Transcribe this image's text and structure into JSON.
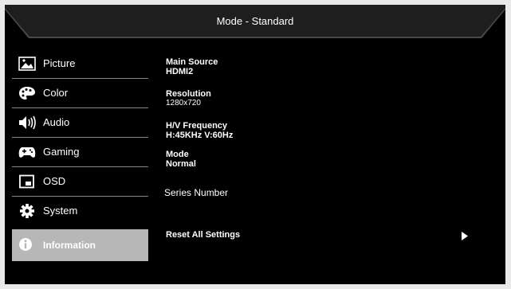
{
  "header": {
    "title": "Mode - Standard"
  },
  "sidebar": {
    "items": [
      {
        "label": "Picture",
        "icon": "picture-icon"
      },
      {
        "label": "Color",
        "icon": "palette-icon"
      },
      {
        "label": "Audio",
        "icon": "speaker-icon"
      },
      {
        "label": "Gaming",
        "icon": "gamepad-icon"
      },
      {
        "label": "OSD",
        "icon": "osd-icon"
      },
      {
        "label": "System",
        "icon": "gear-icon"
      },
      {
        "label": "Information",
        "icon": "info-icon",
        "active": true
      }
    ]
  },
  "info": {
    "main_source": {
      "label": "Main Source",
      "value": "HDMI2"
    },
    "resolution": {
      "label": "Resolution",
      "value": "1280x720"
    },
    "hv_frequency": {
      "label": "H/V Frequency",
      "value": "H:45KHz V:60Hz"
    },
    "mode": {
      "label": "Mode",
      "value": "Normal"
    },
    "series_number": "Series Number",
    "reset_label": "Reset All Settings"
  },
  "colors": {
    "background": "#000000",
    "active_item": "#b7b7b7",
    "text": "#ffffff"
  }
}
